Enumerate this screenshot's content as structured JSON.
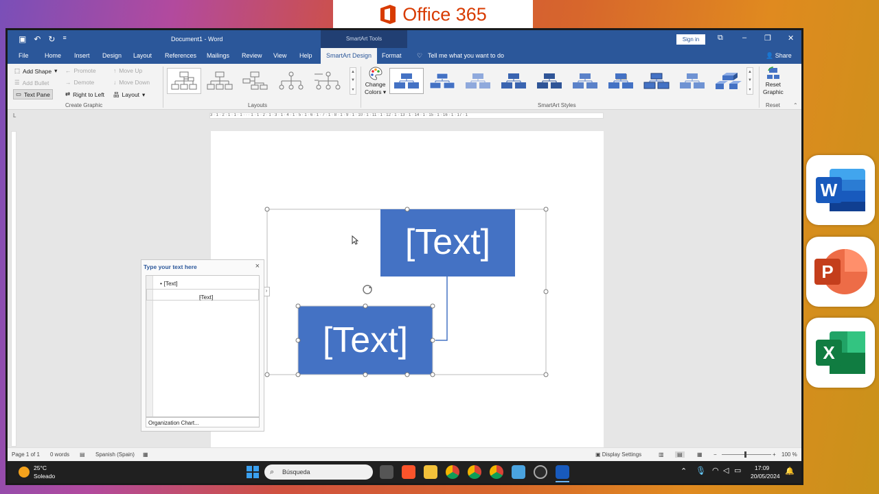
{
  "banner": {
    "title": "Office 365"
  },
  "side_apps": [
    {
      "name": "Word",
      "letter": "W",
      "color": "#185abd"
    },
    {
      "name": "PowerPoint",
      "letter": "P",
      "color": "#c43e1c"
    },
    {
      "name": "Excel",
      "letter": "X",
      "color": "#107c41"
    }
  ],
  "titlebar": {
    "document_title": "Document1 - Word",
    "contextual_tools": "SmartArt Tools",
    "signin_label": "Sign in"
  },
  "tabs": [
    {
      "label": "File"
    },
    {
      "label": "Home"
    },
    {
      "label": "Insert"
    },
    {
      "label": "Design"
    },
    {
      "label": "Layout"
    },
    {
      "label": "References"
    },
    {
      "label": "Mailings"
    },
    {
      "label": "Review"
    },
    {
      "label": "View"
    },
    {
      "label": "Help"
    },
    {
      "label": "SmartArt Design",
      "active": true
    },
    {
      "label": "Format"
    }
  ],
  "tell_me": "Tell me what you want to do",
  "share": "Share",
  "ribbon": {
    "create_graphic": {
      "label": "Create Graphic",
      "add_shape": "Add Shape",
      "add_bullet": "Add Bullet",
      "text_pane": "Text Pane",
      "promote": "Promote",
      "demote": "Demote",
      "right_to_left": "Right to Left",
      "move_up": "Move Up",
      "move_down": "Move Down",
      "layout": "Layout"
    },
    "layouts_label": "Layouts",
    "change_colors_1": "Change",
    "change_colors_2": "Colors",
    "smartart_styles_label": "SmartArt Styles",
    "reset_graphic_1": "Reset",
    "reset_graphic_2": "Graphic",
    "reset_label": "Reset"
  },
  "ruler": "3 · 1 · 2 · 1 · 1 · 1 · · · 1 · 1 · 2 · 1 · 3 · 1 · 4 · 1 · 5 · 1 · 6 · 1 · 7 · 1 · 8 · 1 · 9 · 1 · 10 · 1 · 11 · 1 · 12 · 1 · 13 · 1 · 14 · 1 · 15 · 1 · 16 · 1 · 17 · 1",
  "text_pane": {
    "header": "Type your text here",
    "items": [
      "[Text]",
      "[Text]"
    ],
    "footer": "Organization Chart..."
  },
  "smartart": {
    "top_box": "[Text]",
    "bottom_box": "[Text]",
    "fill": "#4472c4"
  },
  "status": {
    "page": "Page 1 of 1",
    "words": "0 words",
    "language": "Spanish (Spain)",
    "display_settings": "Display Settings",
    "zoom": "100 %"
  },
  "taskbar": {
    "temperature": "25°C",
    "weather": "Soleado",
    "search_placeholder": "Búsqueda",
    "time": "17:09",
    "date": "20/05/2024"
  }
}
